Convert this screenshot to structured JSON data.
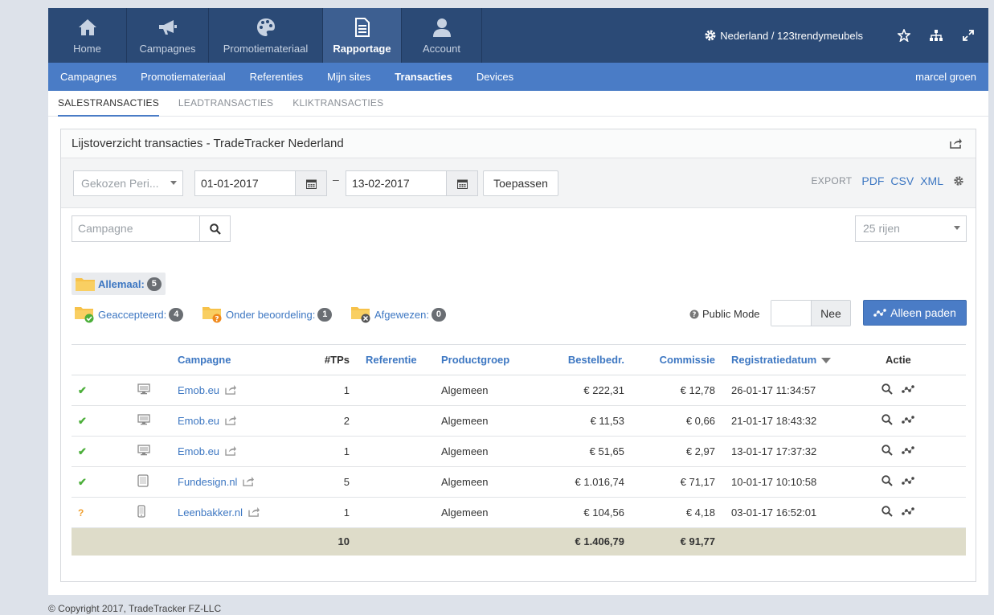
{
  "topnav": {
    "items": [
      {
        "label": "Home",
        "icon": "home-icon"
      },
      {
        "label": "Campagnes",
        "icon": "megaphone-icon"
      },
      {
        "label": "Promotiemateriaal",
        "icon": "palette-icon"
      },
      {
        "label": "Rapportage",
        "icon": "document-icon"
      },
      {
        "label": "Account",
        "icon": "user-icon"
      }
    ],
    "location": "Nederland / 123trendymeubels"
  },
  "subnav": {
    "items": [
      "Campagnes",
      "Promotiemateriaal",
      "Referenties",
      "Mijn sites",
      "Transacties",
      "Devices"
    ],
    "user": "marcel groen"
  },
  "tabs": [
    "SALESTRANSACTIES",
    "LEADTRANSACTIES",
    "KLIKTRANSACTIES"
  ],
  "panel": {
    "title": "Lijstoverzicht transacties - TradeTracker Nederland"
  },
  "filters": {
    "period": "Gekozen Peri...",
    "date_from": "01-01-2017",
    "date_sep": "–",
    "date_to": "13-02-2017",
    "apply": "Toepassen",
    "export_label": "EXPORT",
    "export_pdf": "PDF",
    "export_csv": "CSV",
    "export_xml": "XML",
    "search_placeholder": "Campagne",
    "rows": "25 rijen"
  },
  "folders": {
    "all": {
      "label": "Allemaal:",
      "count": "5"
    },
    "accepted": {
      "label": "Geaccepteerd:",
      "count": "4"
    },
    "pending": {
      "label": "Onder beoordeling:",
      "count": "1"
    },
    "rejected": {
      "label": "Afgewezen:",
      "count": "0"
    }
  },
  "public_mode": {
    "label": "Public Mode",
    "value": "Nee"
  },
  "paths_button": "Alleen paden",
  "table": {
    "headers": {
      "campagne": "Campagne",
      "tps": "#TPs",
      "referentie": "Referentie",
      "productgroep": "Productgroep",
      "bestelbedr": "Bestelbedr.",
      "commissie": "Commissie",
      "registratie": "Registratiedatum",
      "actie": "Actie"
    },
    "rows": [
      {
        "status": "✔",
        "device": "desktop",
        "campaign": "Emob.eu",
        "tps": "1",
        "ref": "",
        "group": "Algemeen",
        "amount": "€ 222,31",
        "commission": "€ 12,78",
        "date": "26-01-17 11:34:57"
      },
      {
        "status": "✔",
        "device": "desktop",
        "campaign": "Emob.eu",
        "tps": "2",
        "ref": "",
        "group": "Algemeen",
        "amount": "€ 11,53",
        "commission": "€ 0,66",
        "date": "21-01-17 18:43:32"
      },
      {
        "status": "✔",
        "device": "desktop",
        "campaign": "Emob.eu",
        "tps": "1",
        "ref": "",
        "group": "Algemeen",
        "amount": "€ 51,65",
        "commission": "€ 2,97",
        "date": "13-01-17 17:37:32"
      },
      {
        "status": "✔",
        "device": "tablet",
        "campaign": "Fundesign.nl",
        "tps": "5",
        "ref": "",
        "group": "Algemeen",
        "amount": "€ 1.016,74",
        "commission": "€ 71,17",
        "date": "10-01-17 10:10:58"
      },
      {
        "status": "?",
        "device": "mobile",
        "campaign": "Leenbakker.nl",
        "tps": "1",
        "ref": "",
        "group": "Algemeen",
        "amount": "€ 104,56",
        "commission": "€ 4,18",
        "date": "03-01-17 16:52:01"
      }
    ],
    "total": {
      "tps": "10",
      "amount": "€ 1.406,79",
      "commission": "€ 91,77"
    }
  },
  "footer": "© Copyright 2017, TradeTracker FZ-LLC"
}
